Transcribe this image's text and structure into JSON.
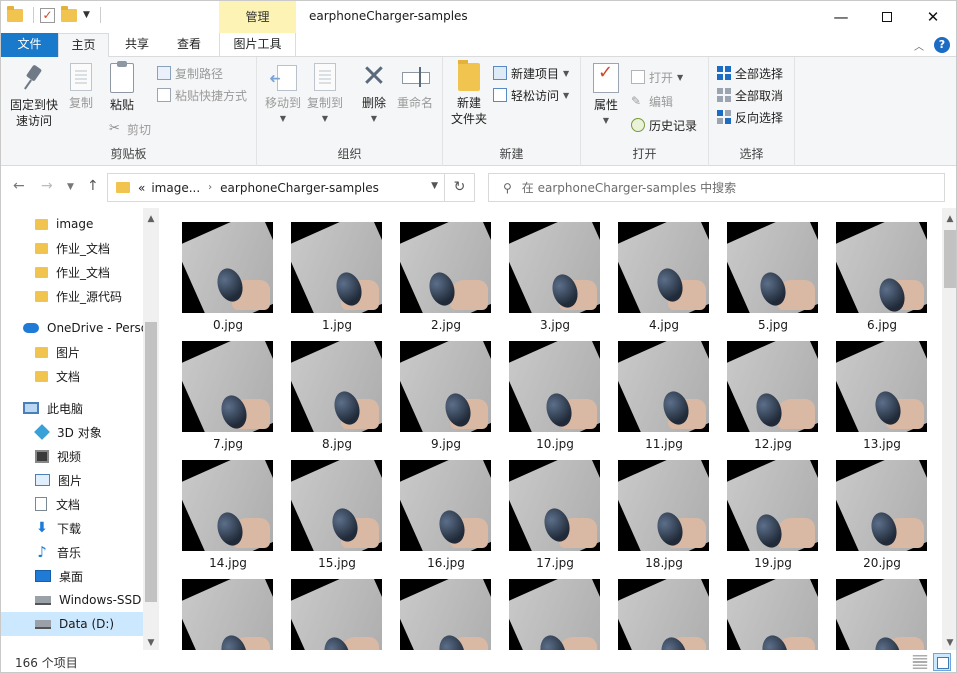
{
  "window": {
    "title": "earphoneCharger-samples",
    "context_tab": "管理",
    "controls": {
      "minimize": "—",
      "maximize": "",
      "close": "✕"
    }
  },
  "ribbon_tabs": {
    "file": "文件",
    "home": "主页",
    "share": "共享",
    "view": "查看",
    "picture_tools": "图片工具",
    "help": "?"
  },
  "ribbon": {
    "clipboard": {
      "label": "剪贴板",
      "pin_line1": "固定到快",
      "pin_line2": "速访问",
      "copy": "复制",
      "paste": "粘贴",
      "copy_path": "复制路径",
      "paste_shortcut": "粘贴快捷方式",
      "cut": "剪切"
    },
    "organize": {
      "label": "组织",
      "move_to": "移动到",
      "copy_to": "复制到",
      "delete": "删除",
      "rename": "重命名"
    },
    "new": {
      "label": "新建",
      "new_folder_line1": "新建",
      "new_folder_line2": "文件夹",
      "new_item": "新建项目",
      "easy_access": "轻松访问"
    },
    "open": {
      "label": "打开",
      "properties": "属性",
      "open": "打开",
      "edit": "编辑",
      "history": "历史记录"
    },
    "select": {
      "label": "选择",
      "select_all": "全部选择",
      "select_none": "全部取消",
      "invert": "反向选择"
    }
  },
  "address": {
    "prefix": "«",
    "parent": "image...",
    "current": "earphoneCharger-samples",
    "separator": "›"
  },
  "search": {
    "placeholder": "在 earphoneCharger-samples 中搜索"
  },
  "sidebar": {
    "items": [
      {
        "label": "image",
        "icon": "folder-icon"
      },
      {
        "label": "作业_文档",
        "icon": "folder-icon"
      },
      {
        "label": "作业_文档",
        "icon": "folder-icon"
      },
      {
        "label": "作业_源代码",
        "icon": "folder-icon"
      },
      {
        "label": "OneDrive - Perso",
        "icon": "onedrive-icon"
      },
      {
        "label": "图片",
        "icon": "folder-icon"
      },
      {
        "label": "文档",
        "icon": "folder-icon"
      },
      {
        "label": "此电脑",
        "icon": "computer-icon"
      },
      {
        "label": "3D 对象",
        "icon": "3d-objects-icon"
      },
      {
        "label": "视频",
        "icon": "video-icon"
      },
      {
        "label": "图片",
        "icon": "pictures-icon"
      },
      {
        "label": "文档",
        "icon": "documents-icon"
      },
      {
        "label": "下载",
        "icon": "download-icon"
      },
      {
        "label": "音乐",
        "icon": "music-icon"
      },
      {
        "label": "桌面",
        "icon": "desktop-icon"
      },
      {
        "label": "Windows-SSD",
        "icon": "drive-icon"
      },
      {
        "label": "Data (D:)",
        "icon": "drive-icon",
        "selected": true
      }
    ]
  },
  "files": [
    "0.jpg",
    "1.jpg",
    "2.jpg",
    "3.jpg",
    "4.jpg",
    "5.jpg",
    "6.jpg",
    "7.jpg",
    "8.jpg",
    "9.jpg",
    "10.jpg",
    "11.jpg",
    "12.jpg",
    "13.jpg",
    "14.jpg",
    "15.jpg",
    "16.jpg",
    "17.jpg",
    "18.jpg",
    "19.jpg",
    "20.jpg",
    "",
    "",
    "",
    "",
    "",
    "",
    ""
  ],
  "status": {
    "item_count": "166 个项目"
  },
  "colors": {
    "file_tab": "#1979ca",
    "manage_tab": "#fcf3b4",
    "selection": "#cce8ff"
  }
}
